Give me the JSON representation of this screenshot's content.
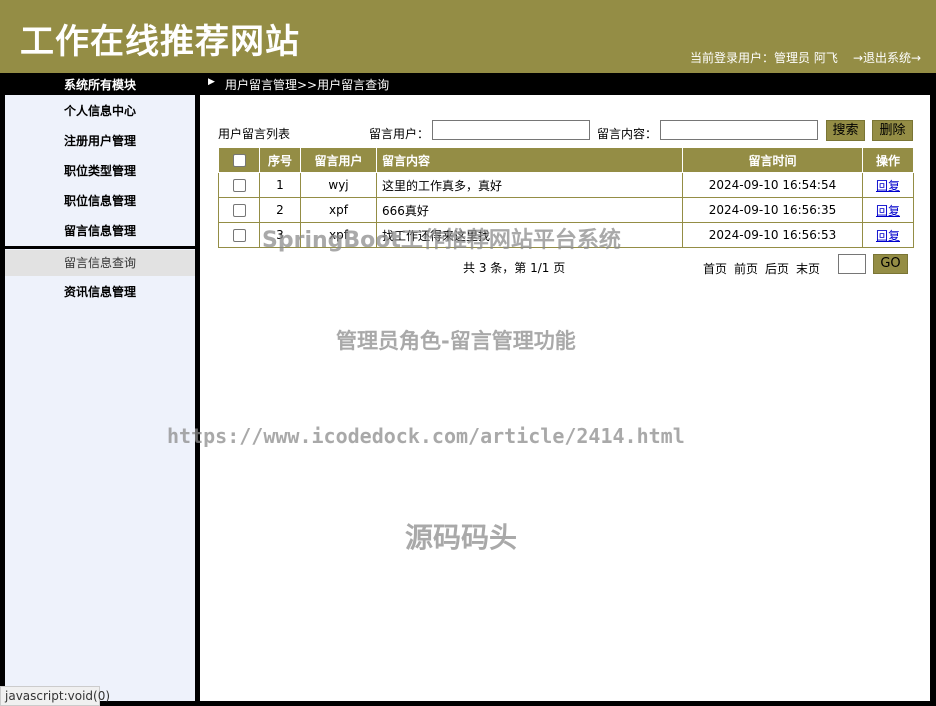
{
  "header": {
    "site_title": "工作在线推荐网站",
    "user_info": "当前登录用户：管理员 阿飞",
    "logout": "→退出系统→"
  },
  "topbar": {
    "module_title": "系统所有模块",
    "breadcrumb": "用户留言管理>>用户留言查询"
  },
  "sidebar": {
    "items": [
      {
        "label": "个人信息中心"
      },
      {
        "label": "注册用户管理"
      },
      {
        "label": "职位类型管理"
      },
      {
        "label": "职位信息管理"
      },
      {
        "label": "留言信息管理"
      },
      {
        "label": "资讯信息管理"
      }
    ],
    "active_sub": "留言信息查询"
  },
  "search": {
    "list_title": "用户留言列表",
    "user_label": "留言用户：",
    "user_value": "",
    "content_label": "留言内容：",
    "content_value": "",
    "search_button": "搜索",
    "delete_button": "删除"
  },
  "table": {
    "headers": [
      "",
      "序号",
      "留言用户",
      "留言内容",
      "留言时间",
      "操作"
    ],
    "rows": [
      {
        "no": "1",
        "user": "wyj",
        "content": "这里的工作真多，真好",
        "time": "2024-09-10 16:54:54",
        "action": "回复"
      },
      {
        "no": "2",
        "user": "xpf",
        "content": "666真好",
        "time": "2024-09-10 16:56:35",
        "action": "回复"
      },
      {
        "no": "3",
        "user": "xpf",
        "content": "找工作还得来这里找",
        "time": "2024-09-10 16:56:53",
        "action": "回复"
      }
    ]
  },
  "pager": {
    "summary": "共 3 条，第 1/1 页",
    "first": "首页",
    "prev": "前页",
    "next": "后页",
    "last": "末页",
    "page_value": "",
    "go": "GO"
  },
  "watermarks": {
    "w1": "SpringBoot工作推荐网站平台系统",
    "w2": "管理员角色-留言管理功能",
    "w3": "https://www.icodedock.com/article/2414.html",
    "w4": "源码码头"
  },
  "status_bar": "javascript:void(0)",
  "colors": {
    "brand": "#948d45",
    "sidebar_bg": "#eef2fb",
    "link": "#0000cc"
  }
}
